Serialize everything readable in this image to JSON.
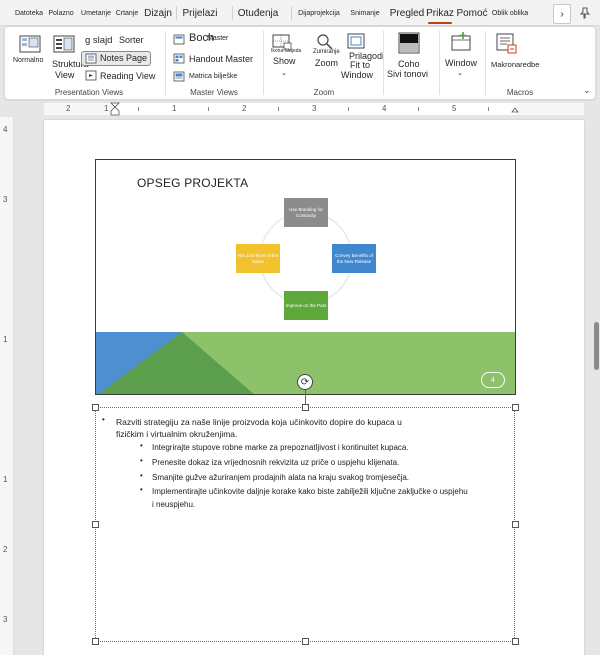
{
  "tabs": [
    {
      "label": "Datoteka",
      "size": "small"
    },
    {
      "label": "Polazno",
      "size": "small"
    },
    {
      "label": "Umetanje",
      "size": "small"
    },
    {
      "label": "Crtanje",
      "size": "small"
    },
    {
      "label": "Dizajn",
      "size": "normal"
    },
    {
      "label": "Prijelazi",
      "size": "normal"
    },
    {
      "label": "Otuđenja",
      "size": "normal"
    },
    {
      "label": "Dijaprojekcija",
      "size": "small"
    },
    {
      "label": "Snimanje",
      "size": "small"
    },
    {
      "label": "Pregled",
      "size": "normal"
    },
    {
      "label": "Prikaz",
      "size": "normal",
      "active": true
    },
    {
      "label": "Pomoć",
      "size": "normal"
    },
    {
      "label": "Oblik oblika",
      "size": "small"
    }
  ],
  "ribbon": {
    "presentation_views": {
      "normal": "Normalno",
      "structure": "Struktura",
      "structure_view": "View",
      "slide_sorter_a": "g slajd",
      "slide_sorter_b": "Sorter",
      "notes_page": "Notes Page",
      "reading_view": "Reading View",
      "group_label": "Presentation Views"
    },
    "master_views": {
      "slide_master_a": "Boch",
      "slide_master_b": "Master",
      "handout_master": "Handout Master",
      "notes_master": "Matrica bilješke",
      "group_label": "Master Views"
    },
    "show": {
      "label": "Show"
    },
    "zoom": {
      "slide_icons": "Ikona Slajeda",
      "zoom_a": "Zumiranje",
      "zoom_b": "Zoom",
      "fit_a": "Prilagodi",
      "fit_b": "Fit to",
      "fit_c": "Window",
      "group_label": "Zoom"
    },
    "color": {
      "label_a": "Coho",
      "label_b": "Sivi tonovi"
    },
    "window": {
      "label": "Window"
    },
    "macros": {
      "label": "Makronaredbe",
      "group_label": "Macros"
    }
  },
  "ruler": {
    "h_numbers": [
      "2",
      "1",
      "1",
      "2",
      "3",
      "4",
      "5"
    ],
    "v_numbers": [
      "4",
      "3",
      "1",
      "1",
      "2",
      "3"
    ]
  },
  "slide": {
    "title": "OPSEG PROJEKTA",
    "boxes": {
      "top": "Use Branding for Continuity",
      "left": "Not Just More of the Same",
      "right": "Convey Benefits of the New Release",
      "bottom": "Improve on the Past"
    },
    "slide_number": "4",
    "colors": {
      "top": "#8c8c8c",
      "left": "#f2c12e",
      "right": "#3f87cf",
      "bottom": "#5fa83a",
      "band_light": "#8dc16a",
      "band_dark": "#5b9f4c",
      "band_blue": "#4d8fd1"
    }
  },
  "notes": {
    "main_line1": "Razviti strategiju za naše linije proizvoda koja učinkovito dopire do kupaca u",
    "main_line2": "fizičkim i virtualnim okruženjima.",
    "sub": [
      "Integrirajte stupove robne marke za prepoznatljivost i kontinuitet kupaca.",
      "Prenesite dokaz iza vrijednosnih rekvizita uz priče o uspjehu klijenata.",
      "Smanjite gužve ažuriranjem prodajnih alata na kraju svakog tromjesečja.",
      "Implementirajte učinkovite daljnje korake kako biste zabilježili ključne zaključke o uspjehu"
    ],
    "sub_last_line2": "i neuspjehu."
  }
}
